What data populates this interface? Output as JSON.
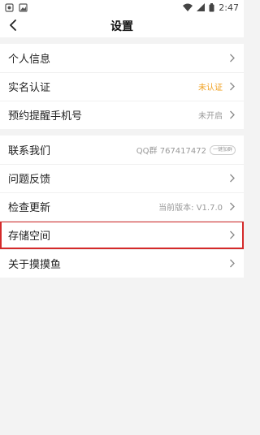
{
  "status_bar": {
    "time": "2:47"
  },
  "header": {
    "title": "设置"
  },
  "group1": {
    "items": [
      {
        "label": "个人信息",
        "value": ""
      },
      {
        "label": "实名认证",
        "value": "未认证"
      },
      {
        "label": "预约提醒手机号",
        "value": "未开启"
      }
    ]
  },
  "group2": {
    "items": [
      {
        "label": "联系我们",
        "value": "QQ群 767417472",
        "badge": "一键加群"
      },
      {
        "label": "问题反馈",
        "value": ""
      },
      {
        "label": "检查更新",
        "value": "当前版本: V1.7.0"
      },
      {
        "label": "存储空间",
        "value": ""
      },
      {
        "label": "关于摸摸鱼",
        "value": ""
      }
    ]
  },
  "colors": {
    "highlight": "#d42a2a",
    "warning": "#f0a020"
  },
  "icons": [
    "back-icon",
    "chevron-right-icon",
    "wifi-icon",
    "signal-icon",
    "battery-icon"
  ]
}
